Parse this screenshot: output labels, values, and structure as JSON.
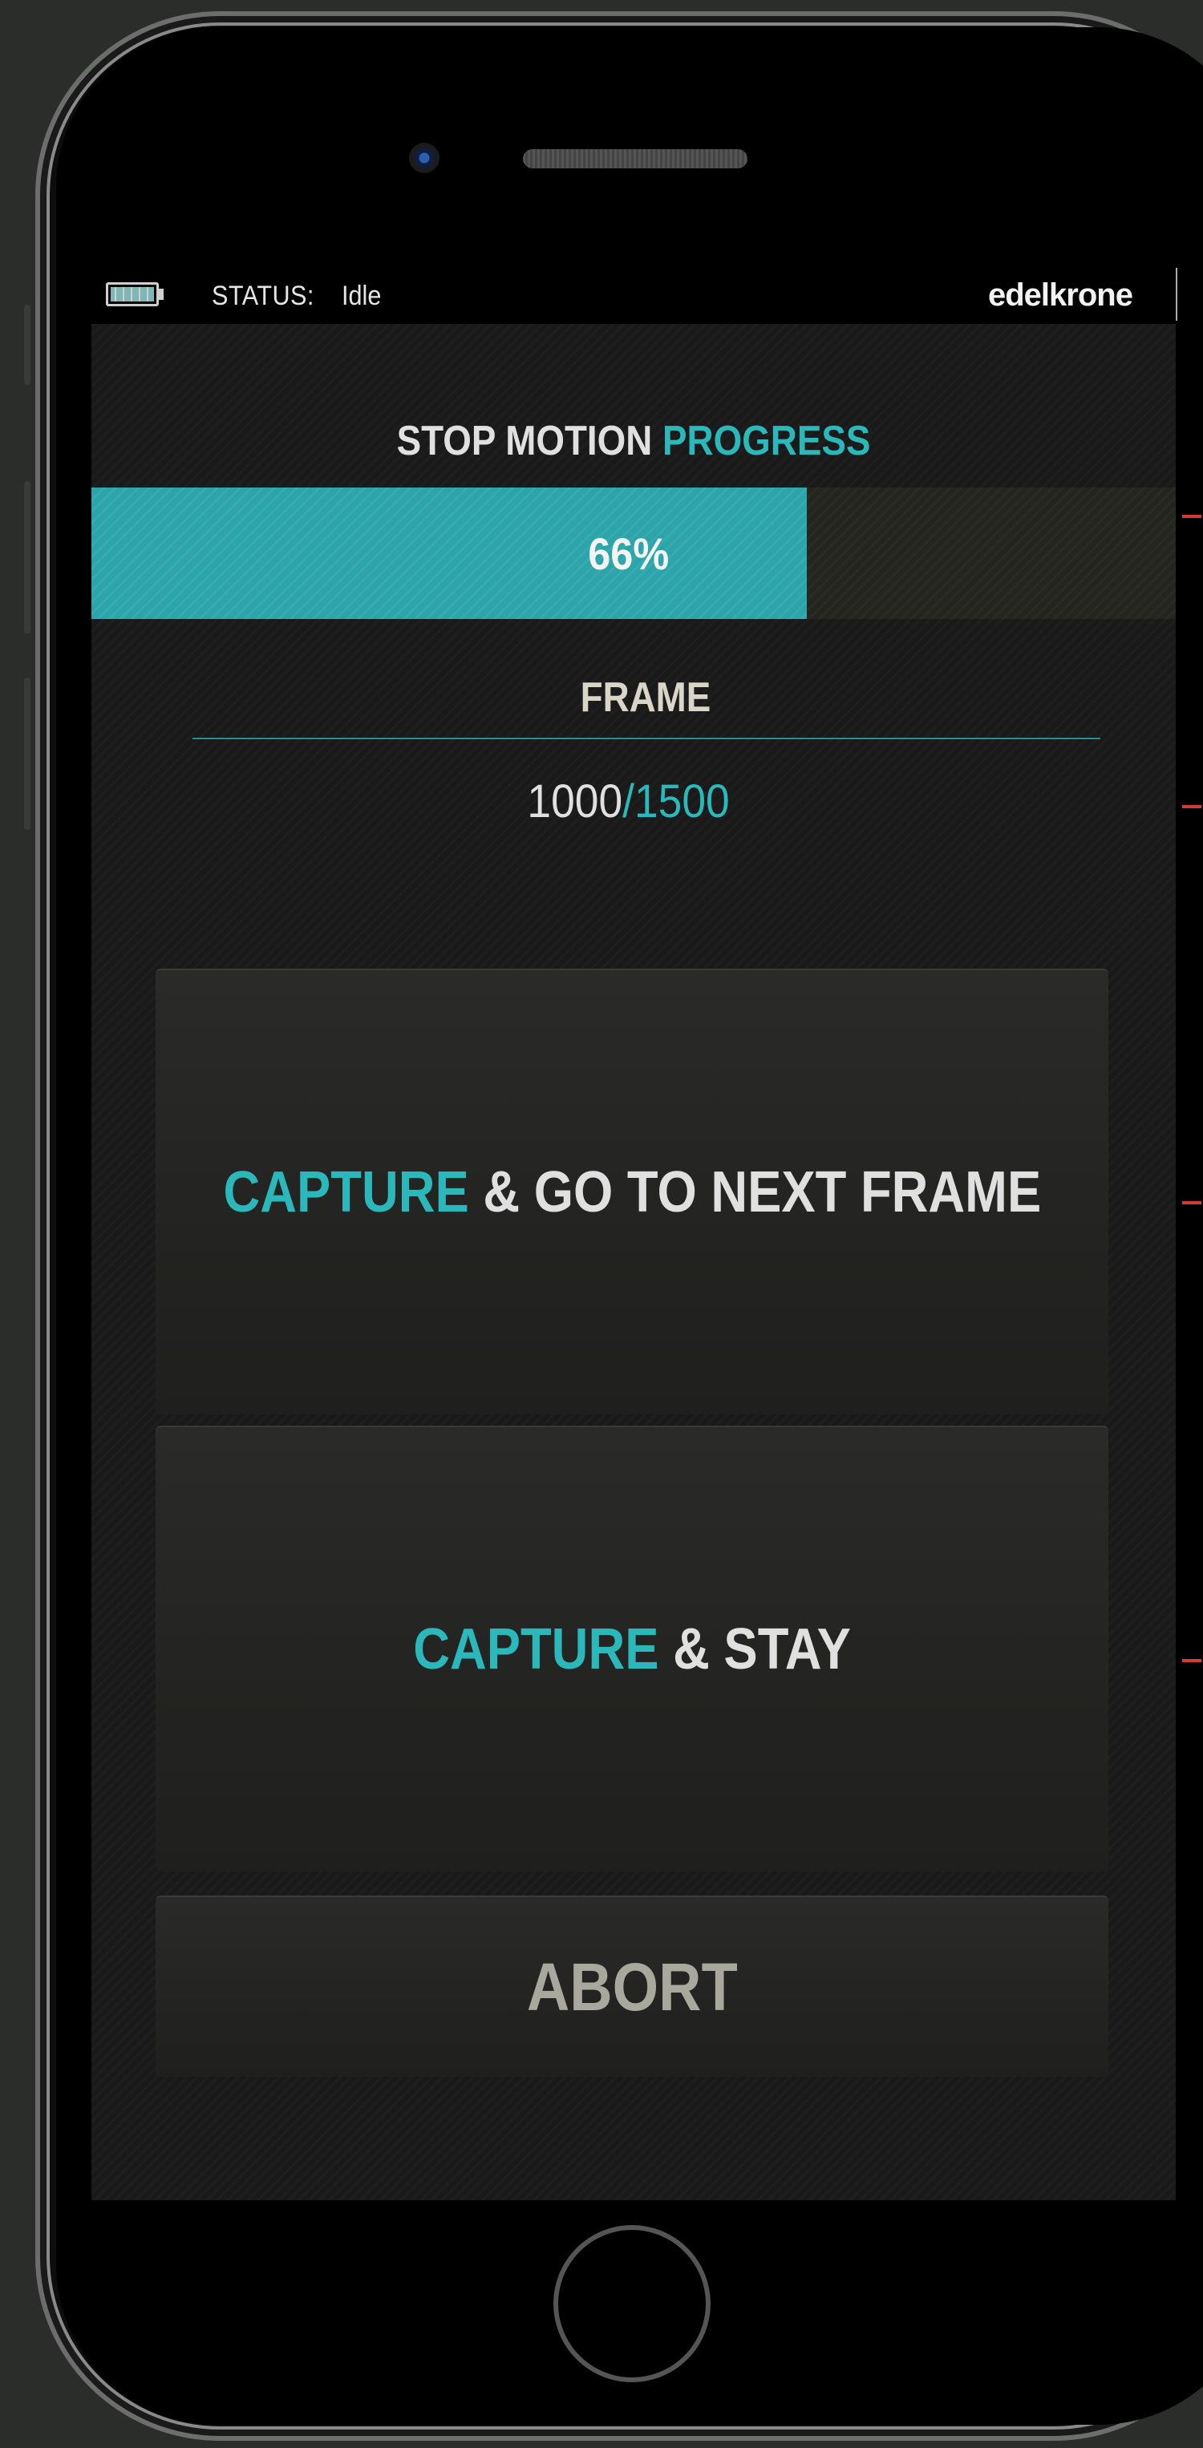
{
  "status_bar": {
    "status_label": "STATUS:",
    "status_value": "Idle",
    "brand": "edelkrone"
  },
  "progress": {
    "title_prefix": "STOP MOTION",
    "title_accent": "PROGRESS",
    "percent": 66,
    "percent_text": "66%"
  },
  "frame": {
    "label": "FRAME",
    "current": "1000",
    "separator": "/",
    "total": "1500"
  },
  "buttons": {
    "next": {
      "accent": "CAPTURE",
      "rest": "& GO TO NEXT FRAME"
    },
    "stay": {
      "accent": "CAPTURE",
      "rest": "& STAY"
    },
    "abort": {
      "label": "ABORT"
    }
  },
  "colors": {
    "accent": "#2ab8bb",
    "progress_fill": "#2ba5aa",
    "screen_bg": "#1a1a1a",
    "marker": "#d43a3a"
  }
}
